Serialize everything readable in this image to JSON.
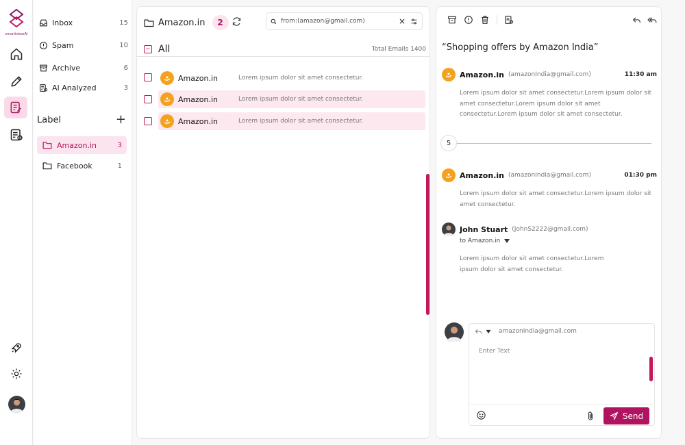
{
  "brand": {
    "name": "smartinboxAI",
    "accent": "#b0135f"
  },
  "sidebar": {
    "folders": [
      {
        "label": "Inbox",
        "count": "15",
        "icon": "inbox-icon"
      },
      {
        "label": "Spam",
        "count": "10",
        "icon": "alert-circle-icon"
      },
      {
        "label": "Archive",
        "count": "6",
        "icon": "archive-icon"
      },
      {
        "label": "AI Analyzed",
        "count": "3",
        "icon": "ai-analyzed-icon"
      }
    ],
    "label_heading": "Label",
    "labels": [
      {
        "label": "Amazon.in",
        "count": "3"
      },
      {
        "label": "Facebook",
        "count": "1"
      }
    ]
  },
  "list": {
    "folder_title": "Amazon.in",
    "badge": "2",
    "search_query": "from:(amazon@gmail.com)",
    "all_label": "All",
    "total": "Total Emails 1400",
    "rows": [
      {
        "sender": "Amazon.in",
        "snippet": "Lorem ipsum dolor sit amet consectetur."
      },
      {
        "sender": "Amazon.in",
        "snippet": "Lorem ipsum dolor sit amet consectetur."
      },
      {
        "sender": "Amazon.in",
        "snippet": "Lorem ipsum dolor sit amet consectetur."
      }
    ]
  },
  "detail": {
    "subject": "“Shopping offers by Amazon India”",
    "collapsed_count": "5",
    "messages": [
      {
        "name": "Amazon.in",
        "email": "(amazonIndia@gmail.com)",
        "time": "11:30 am",
        "body": "Lorem ipsum dolor sit amet consectetur.Lorem ipsum dolor sit amet consectetur.Lorem ipsum dolor sit amet consectetur.Lorem ipsum dolor sit amet consectetur."
      },
      {
        "name": "Amazon.in",
        "email": "(amazonIndia@gmail.com)",
        "time": "01:30 pm",
        "body": "Lorem ipsum dolor sit amet consectetur.Lorem ipsum dolor sit amet consectetur."
      },
      {
        "name": "John Stuart",
        "email": "(JohnS2222@gmail.com)",
        "to": "to Amazon.in",
        "body": "Lorem ipsum dolor sit amet consectetur.Lorem ipsum dolor sit amet consectetur."
      }
    ],
    "composer": {
      "to": "amazonIndia@gmail.com",
      "placeholder": "Enter Text",
      "send_label": "Send"
    }
  }
}
